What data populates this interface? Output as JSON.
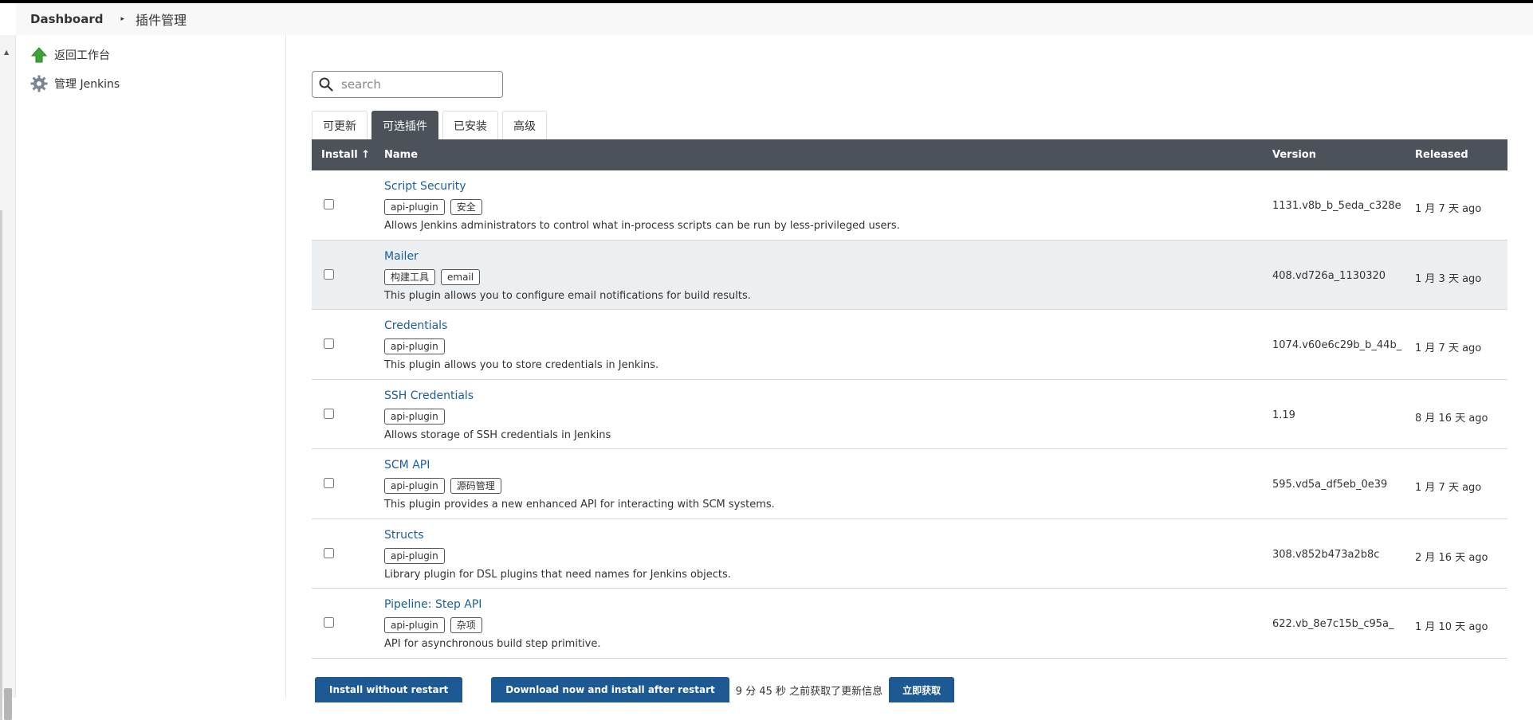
{
  "breadcrumb": {
    "root": "Dashboard",
    "sep": "▸",
    "current": "插件管理"
  },
  "sidebar": {
    "items": [
      {
        "label": "返回工作台",
        "icon": "up-arrow-icon"
      },
      {
        "label": "管理 Jenkins",
        "icon": "gear-icon"
      }
    ]
  },
  "search": {
    "placeholder": "search",
    "value": ""
  },
  "tabs": [
    {
      "label": "可更新",
      "active": false
    },
    {
      "label": "可选插件",
      "active": true
    },
    {
      "label": "已安装",
      "active": false
    },
    {
      "label": "高级",
      "active": false
    }
  ],
  "table": {
    "columns": {
      "install": "Install ↑",
      "name": "Name",
      "version": "Version",
      "released": "Released"
    },
    "rows": [
      {
        "name": "Script Security",
        "tags": [
          "api-plugin",
          "安全"
        ],
        "desc": "Allows Jenkins administrators to control what in-process scripts can be run by less-privileged users.",
        "version": "1131.v8b_b_5eda_c328e",
        "released": "1 月 7 天 ago",
        "checked": false
      },
      {
        "name": "Mailer",
        "tags": [
          "构建工具",
          "email"
        ],
        "desc": "This plugin allows you to configure email notifications for build results.",
        "version": "408.vd726a_1130320",
        "released": "1 月 3 天 ago",
        "checked": false
      },
      {
        "name": "Credentials",
        "tags": [
          "api-plugin"
        ],
        "desc": "This plugin allows you to store credentials in Jenkins.",
        "version": "1074.v60e6c29b_b_44b_",
        "released": "1 月 7 天 ago",
        "checked": false
      },
      {
        "name": "SSH Credentials",
        "tags": [
          "api-plugin"
        ],
        "desc": "Allows storage of SSH credentials in Jenkins",
        "version": "1.19",
        "released": "8 月 16 天 ago",
        "checked": false
      },
      {
        "name": "SCM API",
        "tags": [
          "api-plugin",
          "源码管理"
        ],
        "desc": "This plugin provides a new enhanced API for interacting with SCM systems.",
        "version": "595.vd5a_df5eb_0e39",
        "released": "1 月 7 天 ago",
        "checked": false
      },
      {
        "name": "Structs",
        "tags": [
          "api-plugin"
        ],
        "desc": "Library plugin for DSL plugins that need names for Jenkins objects.",
        "version": "308.v852b473a2b8c",
        "released": "2 月 16 天 ago",
        "checked": false
      },
      {
        "name": "Pipeline: Step API",
        "tags": [
          "api-plugin",
          "杂项"
        ],
        "desc": "API for asynchronous build step primitive.",
        "version": "622.vb_8e7c15b_c95a_",
        "released": "1 月 10 天 ago",
        "checked": false
      }
    ]
  },
  "footer": {
    "install_now": "Install without restart",
    "install_later": "Download now and install after restart",
    "status": "9 分 45 秒 之前获取了更新信息",
    "fetch_now": "立即获取"
  },
  "colors": {
    "header_bg": "#4b525a",
    "link": "#1a5f9b",
    "button": "#1d5a94",
    "row_highlight": "#ebeff2"
  }
}
